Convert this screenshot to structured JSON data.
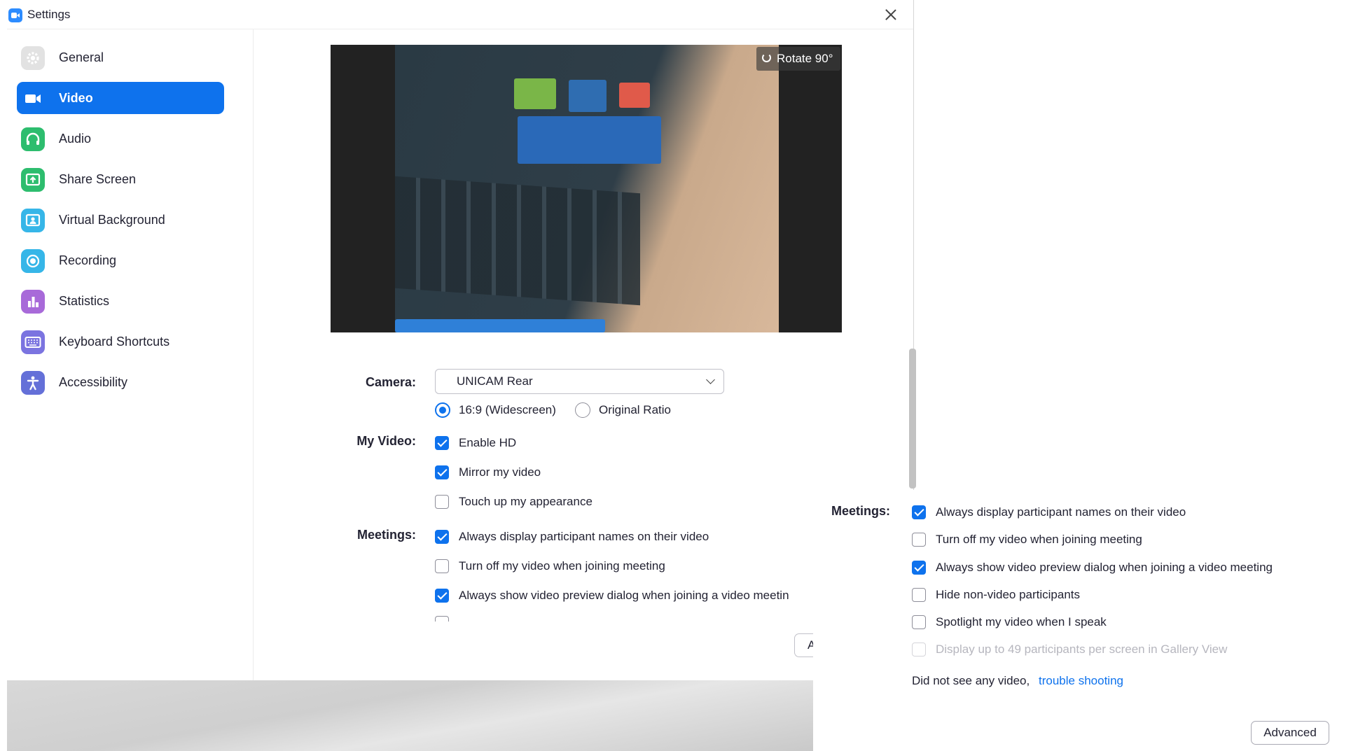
{
  "window": {
    "title": "Settings"
  },
  "sidebar": {
    "items": [
      {
        "label": "General",
        "icon": "gear-icon",
        "color": "#d9d9d9"
      },
      {
        "label": "Video",
        "icon": "video-camera-icon",
        "color": "#ffffff",
        "active": true
      },
      {
        "label": "Audio",
        "icon": "headphones-icon",
        "color": "#2dbd6e"
      },
      {
        "label": "Share Screen",
        "icon": "share-screen-icon",
        "color": "#2dbd6e"
      },
      {
        "label": "Virtual Background",
        "icon": "person-icon",
        "color": "#36b6e8"
      },
      {
        "label": "Recording",
        "icon": "record-icon",
        "color": "#36b6e8"
      },
      {
        "label": "Statistics",
        "icon": "bar-chart-icon",
        "color": "#a86ad9"
      },
      {
        "label": "Keyboard Shortcuts",
        "icon": "keyboard-icon",
        "color": "#7b74e0"
      },
      {
        "label": "Accessibility",
        "icon": "accessibility-icon",
        "color": "#6470d8"
      }
    ]
  },
  "preview": {
    "rotate_label": "Rotate 90°"
  },
  "camera": {
    "label": "Camera:",
    "selected": "UNICAM Rear",
    "ratio_options": [
      {
        "label": "16:9 (Widescreen)",
        "selected": true
      },
      {
        "label": "Original Ratio",
        "selected": false
      }
    ]
  },
  "my_video": {
    "label": "My Video:",
    "options": [
      {
        "label": "Enable HD",
        "checked": true
      },
      {
        "label": "Mirror my video",
        "checked": true
      },
      {
        "label": "Touch up my appearance",
        "checked": false
      }
    ]
  },
  "meetings": {
    "label": "Meetings:",
    "options": [
      {
        "label": "Always display participant names on their video",
        "checked": true
      },
      {
        "label": "Turn off my video when joining meeting",
        "checked": false
      },
      {
        "label": "Always show video preview dialog when joining a video meetin",
        "checked": true
      }
    ]
  },
  "partial_button": {
    "label": "Ac"
  },
  "overlay": {
    "label": "Meetings:",
    "options": [
      {
        "label": "Always display participant names on their video",
        "checked": true
      },
      {
        "label": "Turn off my video when joining meeting",
        "checked": false
      },
      {
        "label": "Always show video preview dialog when joining a video meeting",
        "checked": true
      },
      {
        "label": "Hide non-video participants",
        "checked": false
      },
      {
        "label": "Spotlight my video when I speak",
        "checked": false
      },
      {
        "label": "Display up to 49 participants per screen in Gallery View",
        "checked": false,
        "disabled": true
      }
    ],
    "hint": "Did not see any video,",
    "link": "trouble shooting",
    "advanced_label": "Advanced"
  },
  "colors": {
    "accent": "#0e72ed"
  }
}
